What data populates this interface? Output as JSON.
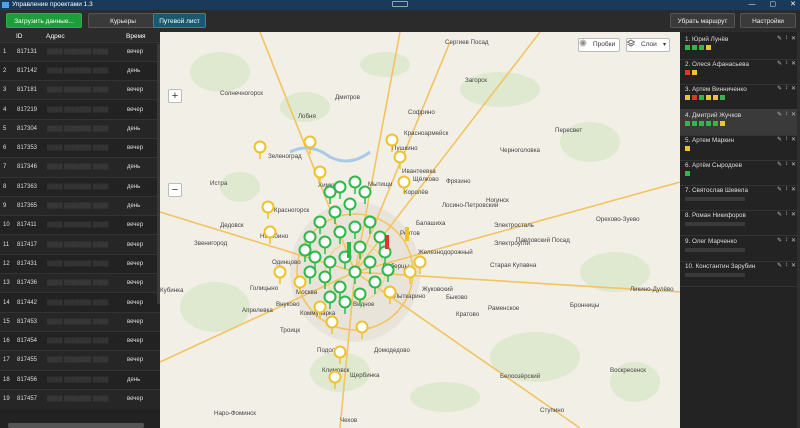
{
  "window": {
    "title": "Управление проектами 1.3",
    "min": "—",
    "max": "▢",
    "close": "✕"
  },
  "toolbar": {
    "load_label": "Загрузить данные...",
    "couriers_label": "Курьеры",
    "waybill_label": "Путевой лист",
    "remove_route_label": "Убрать маршрут",
    "settings_label": "Настройки"
  },
  "orders": {
    "columns": [
      "ID",
      "Адрес",
      "Время"
    ],
    "rows": [
      {
        "n": "1",
        "id": "817131",
        "addr": "▒▒▒▒ ▒▒▒▒▒▒▒ ▒▒▒▒",
        "time": "вечер"
      },
      {
        "n": "2",
        "id": "817142",
        "addr": "▒▒▒▒ ▒▒▒▒▒▒▒ ▒▒▒▒",
        "time": "день"
      },
      {
        "n": "3",
        "id": "817181",
        "addr": "▒▒▒▒ ▒▒▒▒▒▒▒ ▒▒▒▒",
        "time": "вечер"
      },
      {
        "n": "4",
        "id": "817219",
        "addr": "▒▒▒▒ ▒▒▒▒▒▒▒ ▒▒▒▒",
        "time": "вечер"
      },
      {
        "n": "5",
        "id": "817304",
        "addr": "▒▒▒▒ ▒▒▒▒▒▒▒ ▒▒▒▒",
        "time": "день"
      },
      {
        "n": "6",
        "id": "817353",
        "addr": "▒▒▒▒ ▒▒▒▒▒▒▒ ▒▒▒▒",
        "time": "вечер"
      },
      {
        "n": "7",
        "id": "817346",
        "addr": "▒▒▒▒ ▒▒▒▒▒▒▒ ▒▒▒▒",
        "time": "день"
      },
      {
        "n": "8",
        "id": "817363",
        "addr": "▒▒▒▒ ▒▒▒▒▒▒▒ ▒▒▒▒",
        "time": "день"
      },
      {
        "n": "9",
        "id": "817365",
        "addr": "▒▒▒▒ ▒▒▒▒▒▒▒ ▒▒▒▒",
        "time": "день"
      },
      {
        "n": "10",
        "id": "817411",
        "addr": "▒▒▒▒ ▒▒▒▒▒▒▒ ▒▒▒▒",
        "time": "вечер"
      },
      {
        "n": "11",
        "id": "817417",
        "addr": "▒▒▒▒ ▒▒▒▒▒▒▒ ▒▒▒▒",
        "time": "вечер"
      },
      {
        "n": "12",
        "id": "817431",
        "addr": "▒▒▒▒ ▒▒▒▒▒▒▒ ▒▒▒▒",
        "time": "вечер"
      },
      {
        "n": "13",
        "id": "817436",
        "addr": "▒▒▒▒ ▒▒▒▒▒▒▒ ▒▒▒▒",
        "time": "вечер"
      },
      {
        "n": "14",
        "id": "817442",
        "addr": "▒▒▒▒ ▒▒▒▒▒▒▒ ▒▒▒▒",
        "time": "вечер"
      },
      {
        "n": "15",
        "id": "817453",
        "addr": "▒▒▒▒ ▒▒▒▒▒▒▒ ▒▒▒▒",
        "time": "вечер"
      },
      {
        "n": "16",
        "id": "817454",
        "addr": "▒▒▒▒ ▒▒▒▒▒▒▒ ▒▒▒▒",
        "time": "вечер"
      },
      {
        "n": "17",
        "id": "817455",
        "addr": "▒▒▒▒ ▒▒▒▒▒▒▒ ▒▒▒▒",
        "time": "вечер"
      },
      {
        "n": "18",
        "id": "817456",
        "addr": "▒▒▒▒ ▒▒▒▒▒▒▒ ▒▒▒▒",
        "time": "день"
      },
      {
        "n": "19",
        "id": "817457",
        "addr": "▒▒▒▒ ▒▒▒▒▒▒▒ ▒▒▒▒",
        "time": "вечер"
      }
    ]
  },
  "map": {
    "zoom_in": "+",
    "zoom_out": "−",
    "traffic_label": "Пробки",
    "layers_label": "Слои",
    "place_labels": [
      "Сергиев Посад",
      "Зеленоград",
      "Пушкино",
      "Щёлково",
      "Химки",
      "Мытищи",
      "Красногорск",
      "Балашиха",
      "Реутов",
      "Железнодорожный",
      "Люберцы",
      "Одинцово",
      "Москва",
      "Видное",
      "Домодедово",
      "Подольск",
      "Троицк",
      "Ногинск",
      "Электросталь",
      "Жуковский",
      "Раменское",
      "Бронницы",
      "Истра",
      "Звенигород",
      "Апрелевка",
      "Наро-Фоминск",
      "Климовск",
      "Дмитров",
      "Лобня",
      "Солнечногорск",
      "Электроугли",
      "Лыткарино",
      "Королёв",
      "Павловский Посад",
      "Орехово-Зуево",
      "Фрязино",
      "Ивантеевка",
      "Красноармейск",
      "Софрино",
      "Черноголовка",
      "Кубинка",
      "Голицыно",
      "Коммунарка",
      "Внуково",
      "Щербинка",
      "Чехов",
      "Ступино",
      "Воскресенск",
      "Нахабино",
      "Дедовск",
      "Пересвет",
      "Загорск",
      "Ликино-Дулёво",
      "Старая Купавна",
      "Лосино-Петровский",
      "Кратово",
      "Быково",
      "Белоозёрский"
    ]
  },
  "couriers": [
    {
      "n": "1.",
      "name": "Юрий Лунёв",
      "dots": [
        "#2db84a",
        "#2db84a",
        "#2db84a",
        "#e8c62c"
      ]
    },
    {
      "n": "2.",
      "name": "Олеся Афанасьева",
      "dots": [
        "#e2342f",
        "#e8c62c"
      ]
    },
    {
      "n": "3.",
      "name": "Артем Винниченко",
      "dots": [
        "#e8c62c",
        "#e2342f",
        "#2db84a",
        "#e8c62c",
        "#e8c62c",
        "#2db84a"
      ]
    },
    {
      "n": "4.",
      "name": "Дмитрий Жучков",
      "dots": [
        "#2db84a",
        "#2db84a",
        "#2db84a",
        "#2db84a",
        "#2db84a",
        "#e8c62c"
      ]
    },
    {
      "n": "5.",
      "name": "Артем Маркин",
      "dots": [
        "#e8c62c"
      ]
    },
    {
      "n": "6.",
      "name": "Артём Сыродоев",
      "dots": [
        "#2db84a"
      ]
    },
    {
      "n": "7.",
      "name": "Святослав Шевела",
      "dots": []
    },
    {
      "n": "8.",
      "name": "Роман Никифоров",
      "dots": []
    },
    {
      "n": "9.",
      "name": "Олег Марченко",
      "dots": []
    },
    {
      "n": "10.",
      "name": "Константин Зарубин",
      "dots": []
    }
  ],
  "courier_actions": {
    "edit": "✎",
    "up": "↕",
    "del": "✕"
  },
  "colors": {
    "green_btn": "#1e9e3a",
    "teal_btn": "#1b5a6e",
    "map_bg": "#f2efe6"
  }
}
